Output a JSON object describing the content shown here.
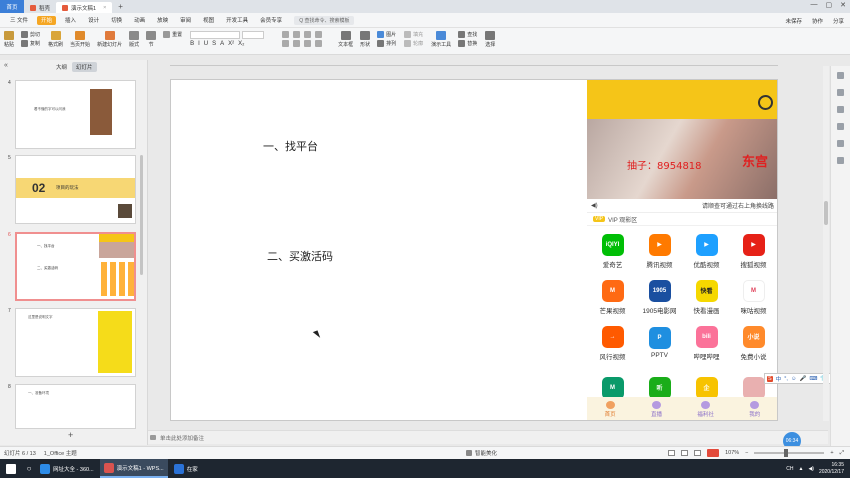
{
  "tabs": {
    "home": "首页",
    "items": [
      {
        "label": "稻壳",
        "color": "#e55b3c"
      },
      {
        "label": "演示文稿1",
        "color": "#e55b3c"
      }
    ],
    "add": "+"
  },
  "menu": {
    "file": "三 文件",
    "items": [
      "开始",
      "插入",
      "设计",
      "切换",
      "动画",
      "放映",
      "审阅",
      "视图",
      "开发工具",
      "会员专享"
    ],
    "active_index": 0,
    "search_placeholder": "Q 查找命令、搜索模板",
    "right": [
      "未保存",
      "协作",
      "分享"
    ]
  },
  "toolbar": {
    "paste": "粘贴",
    "cut": "剪切",
    "copy": "复制",
    "format_painter": "格式刷",
    "from_current": "当页开始",
    "new_slide": "新建幻灯片",
    "layout": "版式",
    "section": "节",
    "reset": "重置",
    "textbox": "文本框",
    "shape": "形状",
    "picture": "图片",
    "arrange": "排列",
    "fill": "填充",
    "outline": "轮廓",
    "presenter_tools": "演示工具",
    "find": "查找",
    "replace": "替换",
    "select": "选择",
    "format_letters": [
      "B",
      "I",
      "U",
      "S",
      "A",
      "X²",
      "X₂"
    ]
  },
  "sidebar": {
    "tab_outline": "大纲",
    "tab_slides": "幻灯片",
    "thumbs": [
      {
        "num": "4",
        "text": "看不懂的字可以问我"
      },
      {
        "num": "5",
        "title": "项目的玩法",
        "big": "02"
      },
      {
        "num": "6",
        "line1": "一、找平台",
        "line2": "二、买激活码"
      },
      {
        "num": "7",
        "text": "这里是说明文字"
      },
      {
        "num": "8",
        "text": "一、准备环境"
      }
    ],
    "add": "+"
  },
  "slide": {
    "text1": "一、找平台",
    "text2": "二、买激活码"
  },
  "phone": {
    "banner_text": "抽子：8954818",
    "banner_brand": "东宫",
    "notice_icon": "speaker-icon",
    "notice": "请顺查可通过右上角换线路",
    "vip_tag": "VIP",
    "section_title": "VIP 观影区",
    "apps": [
      {
        "name": "爱奇艺",
        "color": "#00be06",
        "glyph": "iQIYI"
      },
      {
        "name": "腾讯视频",
        "color": "#ff7a00",
        "glyph": "▶"
      },
      {
        "name": "优酷视频",
        "color": "#1ea0ff",
        "glyph": "▶"
      },
      {
        "name": "搜狐视频",
        "color": "#e62117",
        "glyph": "▶"
      },
      {
        "name": "芒果视频",
        "color": "#ff6a13",
        "glyph": "M"
      },
      {
        "name": "1905电影网",
        "color": "#1a4fa0",
        "glyph": "1905"
      },
      {
        "name": "快看漫画",
        "color": "#f5d800",
        "glyph": "快看"
      },
      {
        "name": "咪咕视频",
        "color": "#ffffff",
        "glyph": "M"
      },
      {
        "name": "风行视频",
        "color": "#ff5a00",
        "glyph": "→"
      },
      {
        "name": "PPTV",
        "color": "#1f8fe0",
        "glyph": "P"
      },
      {
        "name": "哔哩哔哩",
        "color": "#fb7299",
        "glyph": "bili"
      },
      {
        "name": "免费小说",
        "color": "#ff8a2b",
        "glyph": "小说"
      },
      {
        "name": "",
        "color": "#0a9a6a",
        "glyph": "M"
      },
      {
        "name": "",
        "color": "#1aad19",
        "glyph": "听"
      },
      {
        "name": "",
        "color": "#f7c300",
        "glyph": "企"
      },
      {
        "name": "",
        "color": "#e9b0b0",
        "glyph": ""
      }
    ],
    "bottom_nav": [
      "首页",
      "直播",
      "福利社",
      "我的"
    ],
    "bottom_active": 0
  },
  "ime": {
    "logo": "S",
    "items": [
      "中",
      "°,",
      "☺",
      "🎤",
      "⌨",
      "👕",
      "👔",
      "▦"
    ]
  },
  "notes": {
    "placeholder": "单击此处添加备注"
  },
  "badge": "06:34",
  "status": {
    "slide_info": "幻灯片 6 / 13",
    "theme": "1_Office 主题",
    "smart": "智能美化",
    "zoom": "107%"
  },
  "taskbar": {
    "apps": [
      {
        "label": "网址大全 - 360...",
        "color": "#2d8ce8"
      },
      {
        "label": "演示文稿1 - WPS...",
        "color": "#d9534f"
      },
      {
        "label": "在家",
        "color": "#2b72d6"
      }
    ],
    "active_index": 1,
    "time": "16:35",
    "date": "2020/12/17",
    "tray_text": "CH"
  }
}
